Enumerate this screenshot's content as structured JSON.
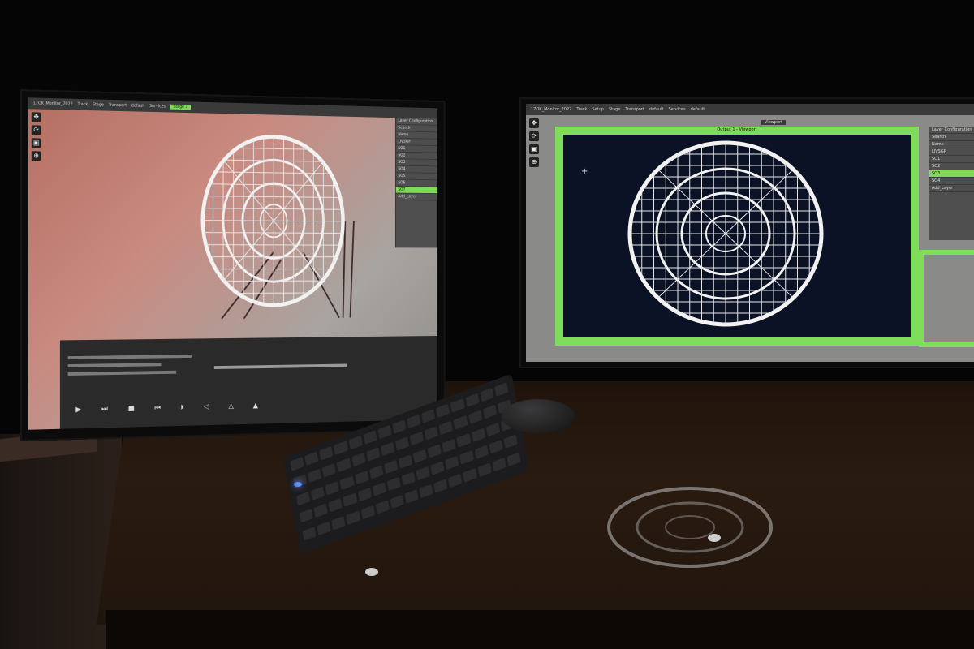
{
  "left_monitor": {
    "topbar": [
      "17OK_Monitor_2022",
      "Track",
      "Stage",
      "Transport",
      "default",
      "Services"
    ],
    "selected_tab": "Stage 1",
    "panel_title": "Layer Configuration",
    "panel_rows": [
      "Search",
      "Name",
      "LIVSGP",
      "SO1",
      "SO2",
      "SO3",
      "SO4",
      "SO5",
      "SO6",
      "SO7",
      "Add_Layer"
    ],
    "highlight_row_index": 9,
    "tools": [
      "✥",
      "⟳",
      "▣",
      "⊕"
    ],
    "transport": [
      "▶",
      "⏭",
      "■",
      "⏮",
      "⏵",
      "◁",
      "△",
      "▲"
    ]
  },
  "right_monitor": {
    "topbar": [
      "17OK_Monitor_2022",
      "Track",
      "Setup",
      "Stage",
      "Transport",
      "default",
      "Services",
      "default"
    ],
    "viewport_label": "Output 1 - Viewport",
    "viewport_tab": "Viewport",
    "panel_title": "Layer Configuration",
    "panel_rows": [
      "Search",
      "Name",
      "LIVSGP",
      "SO1",
      "SO2",
      "SO3",
      "SO4",
      "Add_Layer"
    ],
    "highlight_row_index": 5,
    "tools": [
      "✥",
      "⟳",
      "▣",
      "⊕"
    ]
  },
  "colors": {
    "accent": "#7fdc5a",
    "grid": "#f2f2f2",
    "viewport_bg": "#0c1226"
  }
}
